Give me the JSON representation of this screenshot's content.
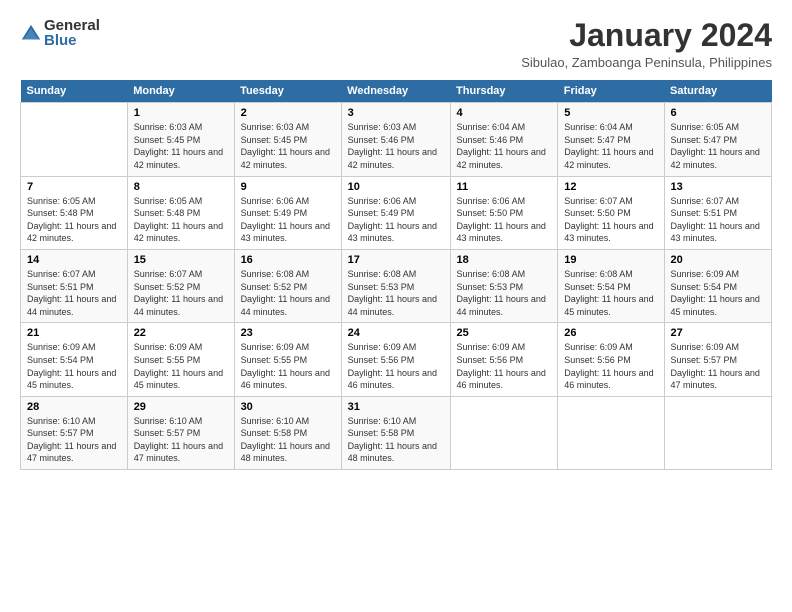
{
  "logo": {
    "general": "General",
    "blue": "Blue"
  },
  "title": "January 2024",
  "subtitle": "Sibulao, Zamboanga Peninsula, Philippines",
  "days_header": [
    "Sunday",
    "Monday",
    "Tuesday",
    "Wednesday",
    "Thursday",
    "Friday",
    "Saturday"
  ],
  "weeks": [
    [
      {
        "num": "",
        "data": ""
      },
      {
        "num": "1",
        "data": "Sunrise: 6:03 AM\nSunset: 5:45 PM\nDaylight: 11 hours and 42 minutes."
      },
      {
        "num": "2",
        "data": "Sunrise: 6:03 AM\nSunset: 5:45 PM\nDaylight: 11 hours and 42 minutes."
      },
      {
        "num": "3",
        "data": "Sunrise: 6:03 AM\nSunset: 5:46 PM\nDaylight: 11 hours and 42 minutes."
      },
      {
        "num": "4",
        "data": "Sunrise: 6:04 AM\nSunset: 5:46 PM\nDaylight: 11 hours and 42 minutes."
      },
      {
        "num": "5",
        "data": "Sunrise: 6:04 AM\nSunset: 5:47 PM\nDaylight: 11 hours and 42 minutes."
      },
      {
        "num": "6",
        "data": "Sunrise: 6:05 AM\nSunset: 5:47 PM\nDaylight: 11 hours and 42 minutes."
      }
    ],
    [
      {
        "num": "7",
        "data": "Sunrise: 6:05 AM\nSunset: 5:48 PM\nDaylight: 11 hours and 42 minutes."
      },
      {
        "num": "8",
        "data": "Sunrise: 6:05 AM\nSunset: 5:48 PM\nDaylight: 11 hours and 42 minutes."
      },
      {
        "num": "9",
        "data": "Sunrise: 6:06 AM\nSunset: 5:49 PM\nDaylight: 11 hours and 43 minutes."
      },
      {
        "num": "10",
        "data": "Sunrise: 6:06 AM\nSunset: 5:49 PM\nDaylight: 11 hours and 43 minutes."
      },
      {
        "num": "11",
        "data": "Sunrise: 6:06 AM\nSunset: 5:50 PM\nDaylight: 11 hours and 43 minutes."
      },
      {
        "num": "12",
        "data": "Sunrise: 6:07 AM\nSunset: 5:50 PM\nDaylight: 11 hours and 43 minutes."
      },
      {
        "num": "13",
        "data": "Sunrise: 6:07 AM\nSunset: 5:51 PM\nDaylight: 11 hours and 43 minutes."
      }
    ],
    [
      {
        "num": "14",
        "data": "Sunrise: 6:07 AM\nSunset: 5:51 PM\nDaylight: 11 hours and 44 minutes."
      },
      {
        "num": "15",
        "data": "Sunrise: 6:07 AM\nSunset: 5:52 PM\nDaylight: 11 hours and 44 minutes."
      },
      {
        "num": "16",
        "data": "Sunrise: 6:08 AM\nSunset: 5:52 PM\nDaylight: 11 hours and 44 minutes."
      },
      {
        "num": "17",
        "data": "Sunrise: 6:08 AM\nSunset: 5:53 PM\nDaylight: 11 hours and 44 minutes."
      },
      {
        "num": "18",
        "data": "Sunrise: 6:08 AM\nSunset: 5:53 PM\nDaylight: 11 hours and 44 minutes."
      },
      {
        "num": "19",
        "data": "Sunrise: 6:08 AM\nSunset: 5:54 PM\nDaylight: 11 hours and 45 minutes."
      },
      {
        "num": "20",
        "data": "Sunrise: 6:09 AM\nSunset: 5:54 PM\nDaylight: 11 hours and 45 minutes."
      }
    ],
    [
      {
        "num": "21",
        "data": "Sunrise: 6:09 AM\nSunset: 5:54 PM\nDaylight: 11 hours and 45 minutes."
      },
      {
        "num": "22",
        "data": "Sunrise: 6:09 AM\nSunset: 5:55 PM\nDaylight: 11 hours and 45 minutes."
      },
      {
        "num": "23",
        "data": "Sunrise: 6:09 AM\nSunset: 5:55 PM\nDaylight: 11 hours and 46 minutes."
      },
      {
        "num": "24",
        "data": "Sunrise: 6:09 AM\nSunset: 5:56 PM\nDaylight: 11 hours and 46 minutes."
      },
      {
        "num": "25",
        "data": "Sunrise: 6:09 AM\nSunset: 5:56 PM\nDaylight: 11 hours and 46 minutes."
      },
      {
        "num": "26",
        "data": "Sunrise: 6:09 AM\nSunset: 5:56 PM\nDaylight: 11 hours and 46 minutes."
      },
      {
        "num": "27",
        "data": "Sunrise: 6:09 AM\nSunset: 5:57 PM\nDaylight: 11 hours and 47 minutes."
      }
    ],
    [
      {
        "num": "28",
        "data": "Sunrise: 6:10 AM\nSunset: 5:57 PM\nDaylight: 11 hours and 47 minutes."
      },
      {
        "num": "29",
        "data": "Sunrise: 6:10 AM\nSunset: 5:57 PM\nDaylight: 11 hours and 47 minutes."
      },
      {
        "num": "30",
        "data": "Sunrise: 6:10 AM\nSunset: 5:58 PM\nDaylight: 11 hours and 48 minutes."
      },
      {
        "num": "31",
        "data": "Sunrise: 6:10 AM\nSunset: 5:58 PM\nDaylight: 11 hours and 48 minutes."
      },
      {
        "num": "",
        "data": ""
      },
      {
        "num": "",
        "data": ""
      },
      {
        "num": "",
        "data": ""
      }
    ]
  ]
}
